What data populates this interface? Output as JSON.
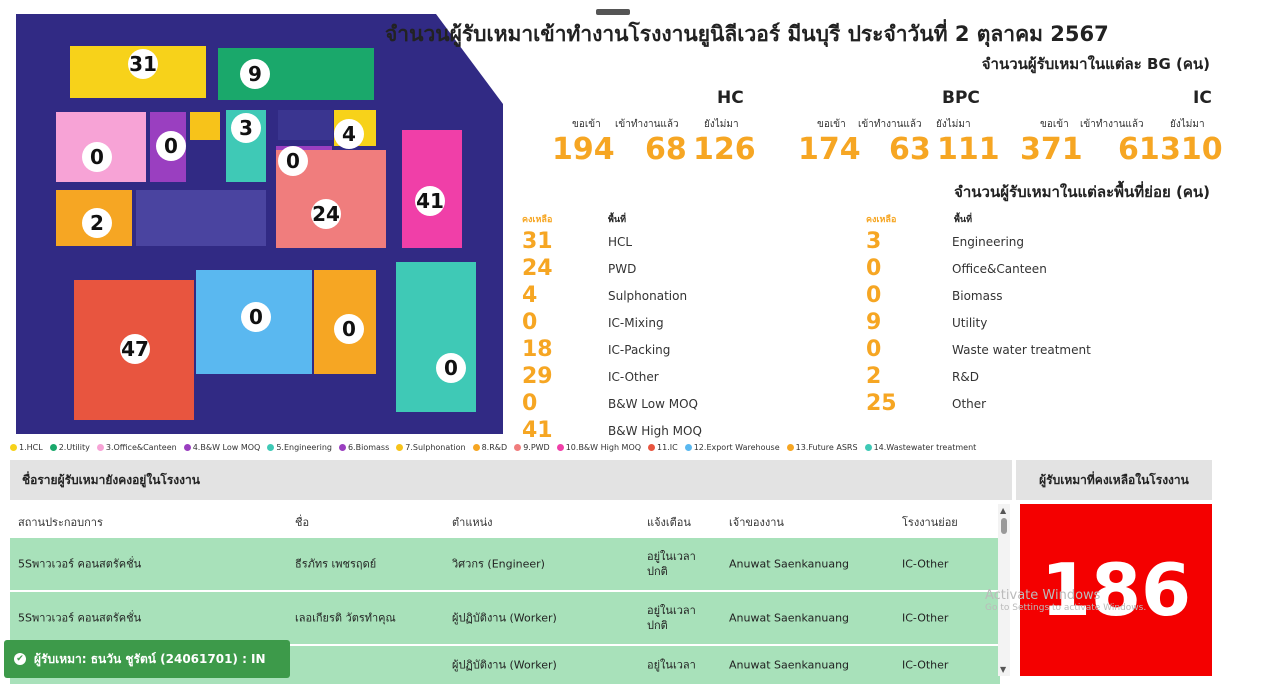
{
  "header": {
    "title": "จำนวนผู้รับเหมาเข้าทำงานโรงงานยูนิลีเวอร์ มีนบุรี ประจำวันที่ 2 ตุลาคม 2567",
    "subtitle_bg": "จำนวนผู้รับเหมาในแต่ละ BG (คน)",
    "subtitle_area": "จำนวนผู้รับเหมาในแต่ละพื้นที่ย่อย (คน)"
  },
  "bg_stats": [
    {
      "name": "HC",
      "labels": [
        "ขอเข้า",
        "เข้าทำงานแล้ว",
        "ยังไม่มา"
      ],
      "values": [
        "194",
        "68",
        "126"
      ]
    },
    {
      "name": "BPC",
      "labels": [
        "ขอเข้า",
        "เข้าทำงานแล้ว",
        "ยังไม่มา"
      ],
      "values": [
        "174",
        "63",
        "111"
      ]
    },
    {
      "name": "IC",
      "labels": [
        "ขอเข้า",
        "เข้าทำงานแล้ว",
        "ยังไม่มา"
      ],
      "values": [
        "371",
        "61",
        "310"
      ]
    }
  ],
  "area_headers": {
    "remaining": "คงเหลือ",
    "area": "พื้นที่"
  },
  "areas_left": [
    {
      "v": "31",
      "n": "HCL"
    },
    {
      "v": "24",
      "n": "PWD"
    },
    {
      "v": "4",
      "n": "Sulphonation"
    },
    {
      "v": "0",
      "n": "IC-Mixing"
    },
    {
      "v": "18",
      "n": "IC-Packing"
    },
    {
      "v": "29",
      "n": "IC-Other"
    },
    {
      "v": "0",
      "n": "B&W Low MOQ"
    },
    {
      "v": "41",
      "n": "B&W High MOQ"
    }
  ],
  "areas_right": [
    {
      "v": "3",
      "n": "Engineering"
    },
    {
      "v": "0",
      "n": "Office&Canteen"
    },
    {
      "v": "0",
      "n": "Biomass"
    },
    {
      "v": "9",
      "n": "Utility"
    },
    {
      "v": "0",
      "n": "Waste water treatment"
    },
    {
      "v": "2",
      "n": "R&D"
    },
    {
      "v": "25",
      "n": "Other"
    }
  ],
  "map_badges": [
    "31",
    "9",
    "0",
    "0",
    "3",
    "4",
    "0",
    "24",
    "41",
    "2",
    "0",
    "0",
    "47",
    "0"
  ],
  "legend": [
    {
      "t": "1.HCL",
      "c": "#f7d21a"
    },
    {
      "t": "2.Utility",
      "c": "#1aa86b"
    },
    {
      "t": "3.Office&Canteen",
      "c": "#f7a3d6"
    },
    {
      "t": "4.B&W Low MOQ",
      "c": "#9a3fc0"
    },
    {
      "t": "5.Engineering",
      "c": "#3fc9b6"
    },
    {
      "t": "6.Biomass",
      "c": "#9a3fc0"
    },
    {
      "t": "7.Sulphonation",
      "c": "#f7c31a"
    },
    {
      "t": "8.R&D",
      "c": "#f6a623"
    },
    {
      "t": "9.PWD",
      "c": "#f07d7d"
    },
    {
      "t": "10.B&W High MOQ",
      "c": "#f03fa8"
    },
    {
      "t": "11.IC",
      "c": "#e8553f"
    },
    {
      "t": "12.Export Warehouse",
      "c": "#5ab8f0"
    },
    {
      "t": "13.Future ASRS",
      "c": "#f6a623"
    },
    {
      "t": "14.Wastewater treatment",
      "c": "#3fc9b6"
    }
  ],
  "table": {
    "title": "ชื่อรายผู้รับเหมายังคงอยู่ในโรงงาน",
    "columns": [
      "สถานประกอบการ",
      "ชื่อ",
      "ตำแหน่ง",
      "แจ้งเตือน",
      "เจ้าของงาน",
      "โรงงานย่อย"
    ],
    "rows": [
      [
        "5Sพาวเวอร์ คอนสตรัคชั่น",
        "ธีรภัทร เพชรฤดย์",
        "วิศวกร (Engineer)",
        "อยู่ในเวลา ปกติ",
        "Anuwat Saenkanuang",
        "IC-Other"
      ],
      [
        "5Sพาวเวอร์ คอนสตรัคชั่น",
        "เลอเกียรติ วัตรทำคุณ",
        "ผู้ปฏิบัติงาน (Worker)",
        "อยู่ในเวลา ปกติ",
        "Anuwat Saenkanuang",
        "IC-Other"
      ],
      [
        "5Sพาวเวอร์ คอนสตรัคชั่น",
        "",
        "ผู้ปฏิบัติงาน (Worker)",
        "อยู่ในเวลา",
        "Anuwat Saenkanuang",
        "IC-Other"
      ]
    ]
  },
  "remaining_panel": {
    "title": "ผู้รับเหมาที่คงเหลือในโรงงาน",
    "value": "186"
  },
  "watermark": {
    "line1": "Activate Windows",
    "line2": "Go to Settings to activate Windows."
  },
  "toast": {
    "text": "ผู้รับเหมา: ธนวัน ชูรัตน์ (24061701) : IN",
    "icon": "check-icon"
  }
}
